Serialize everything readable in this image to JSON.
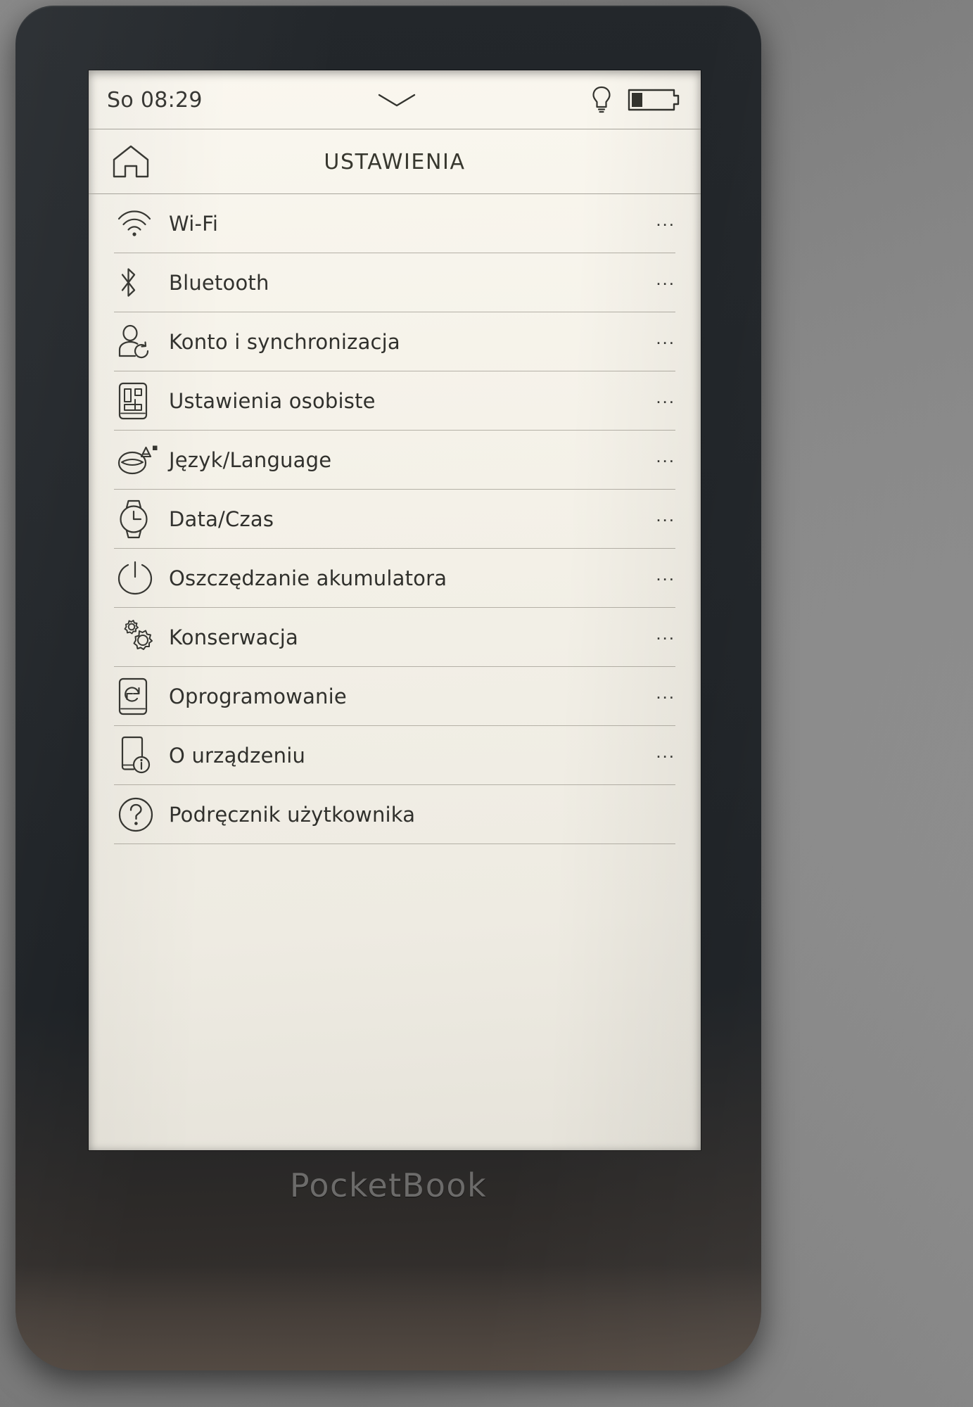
{
  "device": {
    "brand": "PocketBook",
    "bezel_color": "#23272b",
    "background_color": "#8e8e8e",
    "screen_color": "#f4f1e8"
  },
  "statusbar": {
    "clock": "So 08:29",
    "center_icon": "chevron-down-icon",
    "frontlight_icon": "lightbulb-icon",
    "battery_icon": "battery-icon",
    "battery_level_percent": 22
  },
  "header": {
    "home_icon": "home-icon",
    "title": "USTAWIENIA"
  },
  "settings": {
    "more_indicator": "...",
    "items": [
      {
        "label": "Wi-Fi",
        "icon": "wifi-icon",
        "has_more": true
      },
      {
        "label": "Bluetooth",
        "icon": "bluetooth-icon",
        "has_more": true
      },
      {
        "label": "Konto i synchronizacja",
        "icon": "account-sync-icon",
        "has_more": true
      },
      {
        "label": "Ustawienia osobiste",
        "icon": "personalize-icon",
        "has_more": true
      },
      {
        "label": "Język/Language",
        "icon": "language-lips-icon",
        "has_more": true
      },
      {
        "label": "Data/Czas",
        "icon": "watch-clock-icon",
        "has_more": true
      },
      {
        "label": "Oszczędzanie akumulatora",
        "icon": "power-icon",
        "has_more": true
      },
      {
        "label": "Konserwacja",
        "icon": "gears-icon",
        "has_more": true
      },
      {
        "label": "Oprogramowanie",
        "icon": "device-refresh-icon",
        "has_more": true
      },
      {
        "label": "O urządzeniu",
        "icon": "device-info-icon",
        "has_more": true
      },
      {
        "label": "Podręcznik użytkownika",
        "icon": "question-mark-icon",
        "has_more": false
      }
    ]
  }
}
